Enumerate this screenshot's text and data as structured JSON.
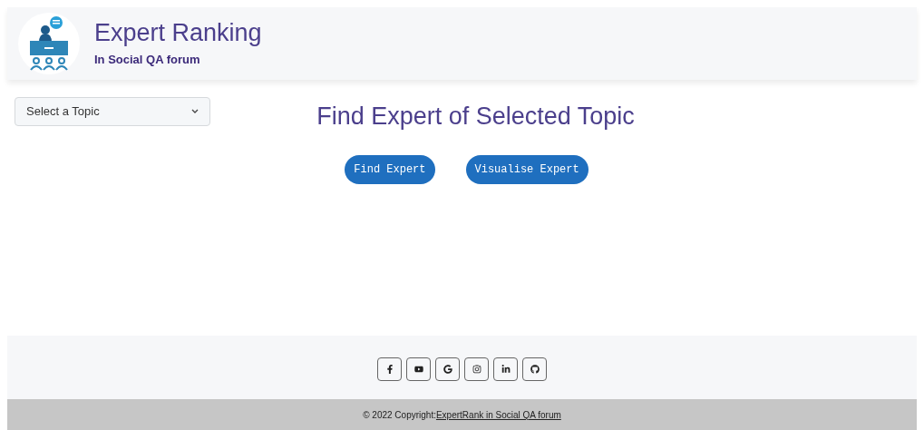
{
  "header": {
    "title": "Expert Ranking",
    "subtitle": "In Social QA forum"
  },
  "topic_select": {
    "placeholder": "Select a Topic"
  },
  "heading": "Find Expert of Selected Topic",
  "buttons": [
    "Find Expert",
    "Visualise Expert"
  ],
  "social_links": [
    {
      "kind": "facebook"
    },
    {
      "kind": "youtube"
    },
    {
      "kind": "google"
    },
    {
      "kind": "instagram"
    },
    {
      "kind": "linkedin"
    },
    {
      "kind": "github"
    }
  ],
  "copyright": {
    "text": "© 2022 Copyright:",
    "link": "ExpertRank in Social QA forum"
  }
}
